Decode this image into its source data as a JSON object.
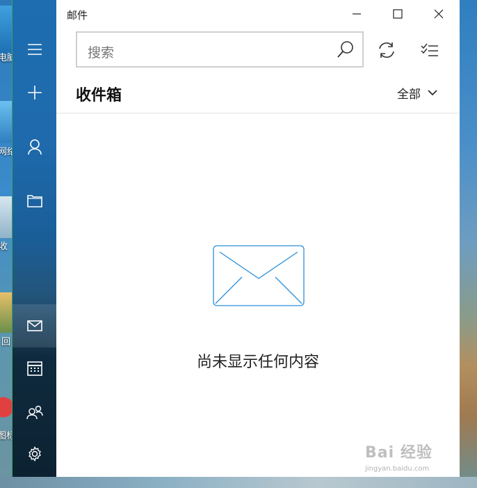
{
  "desktop": {
    "labels": [
      "电脑",
      "网络",
      "收",
      "回",
      "图标"
    ]
  },
  "app": {
    "title": "邮件"
  },
  "search": {
    "placeholder": "搜索"
  },
  "folder": {
    "title": "收件箱",
    "filter_label": "全部"
  },
  "empty_state": {
    "message": "尚未显示任何内容"
  },
  "watermark": {
    "text": "Bai 经验",
    "sub": "jingyan.baidu.com"
  },
  "colors": {
    "accent": "#1e6aac",
    "envelope_stroke": "#2a8fd8",
    "window_border": "#3aa35a"
  },
  "icons": {
    "sidebar": [
      "hamburger-icon",
      "plus-icon",
      "person-icon",
      "folder-icon",
      "mail-icon",
      "calendar-icon",
      "people-icon",
      "gear-icon"
    ],
    "toolbar": [
      "search-icon",
      "sync-icon",
      "select-mode-icon"
    ]
  }
}
